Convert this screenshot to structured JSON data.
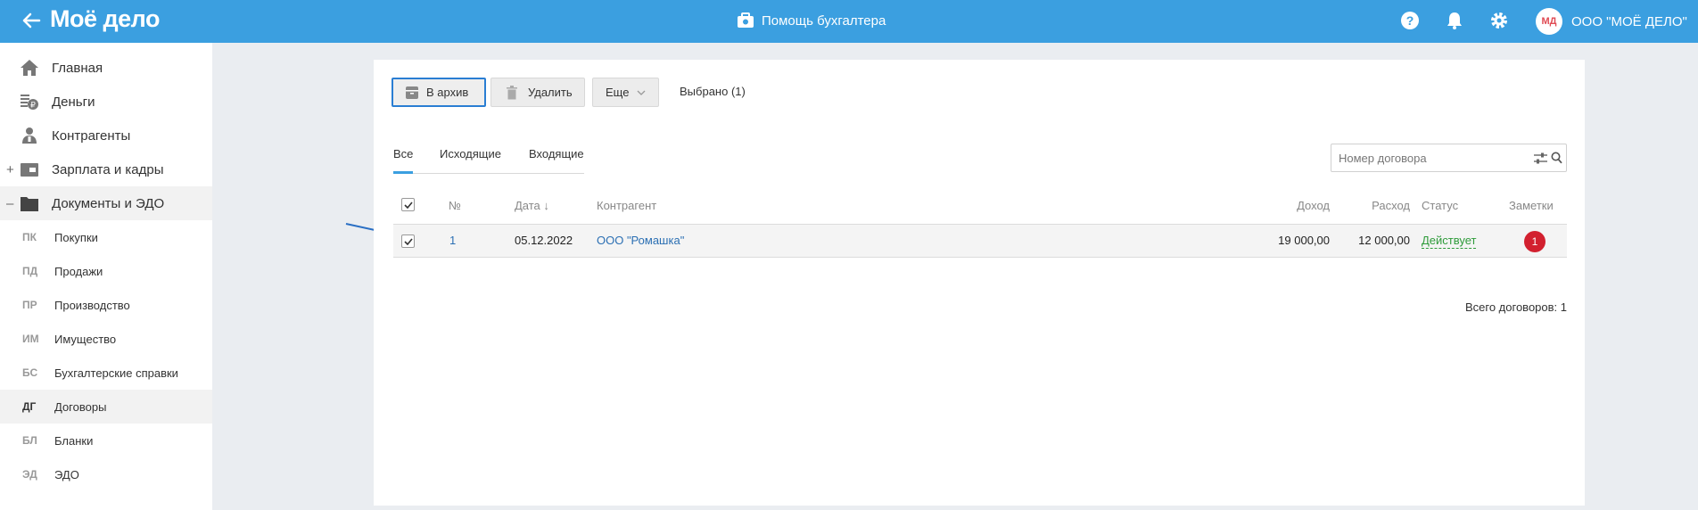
{
  "header": {
    "logo": "Моё дело",
    "helper_label": "Помощь бухгалтера",
    "avatar_initials": "МД",
    "org_name": "ООО \"МОЁ ДЕЛО\"",
    "accent_color": "#3b9fe0"
  },
  "sidebar": {
    "items": [
      {
        "label": "Главная",
        "icon": "home-icon"
      },
      {
        "label": "Деньги",
        "icon": "money-icon"
      },
      {
        "label": "Контрагенты",
        "icon": "contractors-icon"
      },
      {
        "label": "Зарплата и кадры",
        "icon": "salary-icon",
        "sign": "+"
      },
      {
        "label": "Документы и ЭДО",
        "icon": "folder-icon",
        "sign": "–"
      }
    ],
    "subitems": [
      {
        "code": "ПК",
        "label": "Покупки"
      },
      {
        "code": "ПД",
        "label": "Продажи"
      },
      {
        "code": "ПР",
        "label": "Производство"
      },
      {
        "code": "ИМ",
        "label": "Имущество"
      },
      {
        "code": "БС",
        "label": "Бухгалтерские справки"
      },
      {
        "code": "ДГ",
        "label": "Договоры"
      },
      {
        "code": "БЛ",
        "label": "Бланки"
      },
      {
        "code": "ЭД",
        "label": "ЭДО"
      }
    ]
  },
  "toolbar": {
    "archive_label": "В архив",
    "delete_label": "Удалить",
    "more_label": "Еще",
    "selected_text": "Выбрано (1)"
  },
  "tabs": [
    "Все",
    "Исходящие",
    "Входящие"
  ],
  "search": {
    "placeholder": "Номер договора"
  },
  "table": {
    "columns": [
      "№",
      "Дата ↓",
      "Контрагент",
      "Доход",
      "Расход",
      "Статус",
      "Заметки"
    ],
    "rows": [
      {
        "number": "1",
        "date": "05.12.2022",
        "contractor": "ООО \"Ромашка\"",
        "income": "19 000,00",
        "expense": "12 000,00",
        "status": "Действует",
        "notes": "1"
      }
    ]
  },
  "footer": {
    "total": "Всего договоров: 1"
  }
}
